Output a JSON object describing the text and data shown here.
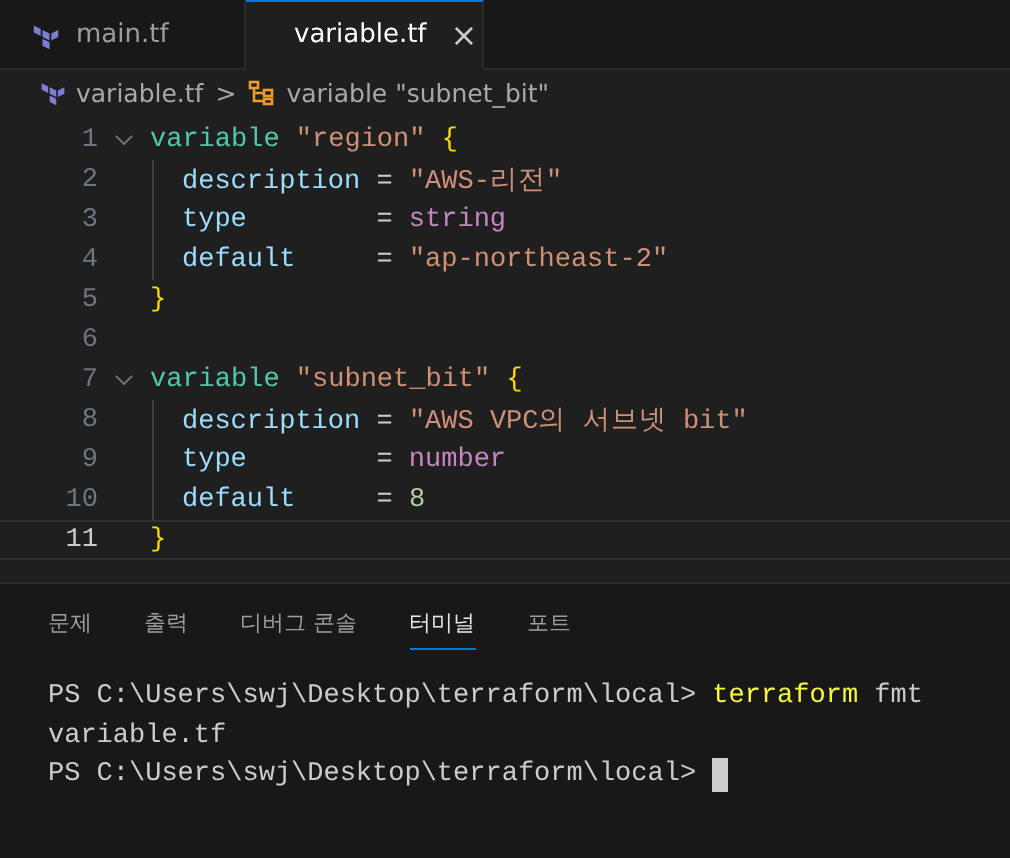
{
  "tabs": [
    {
      "label": "main.tf",
      "selected": false
    },
    {
      "label": "variable.tf",
      "selected": true,
      "close": "×"
    }
  ],
  "breadcrumbs": {
    "file": "variable.tf",
    "separator": ">",
    "symbol": "variable \"subnet_bit\""
  },
  "code": [
    {
      "number": "1",
      "fold": true,
      "indent": false,
      "current": false,
      "tokens": [
        {
          "kind": "keyword",
          "text": "variable"
        },
        {
          "kind": "label",
          "text": " \"region\""
        },
        {
          "kind": "brace",
          "text": " {"
        }
      ]
    },
    {
      "number": "2",
      "fold": false,
      "indent": true,
      "current": false,
      "tokens": [
        {
          "kind": "attr",
          "text": "description"
        },
        {
          "kind": "plain",
          "text": " = "
        },
        {
          "kind": "string",
          "text": "\"AWS-리전\""
        }
      ]
    },
    {
      "number": "3",
      "fold": false,
      "indent": true,
      "current": false,
      "tokens": [
        {
          "kind": "attr",
          "text": "type"
        },
        {
          "kind": "plain",
          "text": "        = "
        },
        {
          "kind": "type",
          "text": "string"
        }
      ]
    },
    {
      "number": "4",
      "fold": false,
      "indent": true,
      "current": false,
      "tokens": [
        {
          "kind": "attr",
          "text": "default"
        },
        {
          "kind": "plain",
          "text": "     = "
        },
        {
          "kind": "string",
          "text": "\"ap-northeast-2\""
        }
      ]
    },
    {
      "number": "5",
      "fold": false,
      "indent": false,
      "current": false,
      "tokens": [
        {
          "kind": "brace",
          "text": "}"
        }
      ]
    },
    {
      "number": "6",
      "fold": false,
      "indent": false,
      "current": false
    },
    {
      "number": "7",
      "fold": true,
      "indent": false,
      "current": false,
      "tokens": [
        {
          "kind": "keyword",
          "text": "variable"
        },
        {
          "kind": "label",
          "text": " \"subnet_bit\""
        },
        {
          "kind": "brace",
          "text": " {"
        }
      ]
    },
    {
      "number": "8",
      "fold": false,
      "indent": true,
      "current": false,
      "tokens": [
        {
          "kind": "attr",
          "text": "description"
        },
        {
          "kind": "plain",
          "text": " = "
        },
        {
          "kind": "string",
          "text": "\"AWS VPC의 서브넷 bit\""
        }
      ]
    },
    {
      "number": "9",
      "fold": false,
      "indent": true,
      "current": false,
      "tokens": [
        {
          "kind": "attr",
          "text": "type"
        },
        {
          "kind": "plain",
          "text": "        = "
        },
        {
          "kind": "type",
          "text": "number"
        }
      ]
    },
    {
      "number": "10",
      "fold": false,
      "indent": true,
      "current": false,
      "tokens": [
        {
          "kind": "attr",
          "text": "default"
        },
        {
          "kind": "plain",
          "text": "     = "
        },
        {
          "kind": "number",
          "text": "8"
        }
      ]
    },
    {
      "number": "11",
      "fold": false,
      "indent": false,
      "current": true,
      "tokens": [
        {
          "kind": "brace",
          "text": "}"
        }
      ]
    }
  ],
  "panel_tabs": [
    {
      "label": "문제",
      "selected": false
    },
    {
      "label": "출력",
      "selected": false
    },
    {
      "label": "디버그 콘솔",
      "selected": false
    },
    {
      "label": "터미널",
      "selected": true
    },
    {
      "label": "포트",
      "selected": false
    }
  ],
  "terminal": [
    {
      "tokens": [
        {
          "kind": "plain",
          "text": "PS C:\\Users\\swj\\Desktop\\terraform\\local> "
        },
        {
          "kind": "command",
          "text": "terraform"
        },
        {
          "kind": "plain",
          "text": " fmt"
        }
      ],
      "cursor": false
    },
    {
      "tokens": [
        {
          "kind": "plain",
          "text": "variable.tf"
        }
      ],
      "cursor": false
    },
    {
      "tokens": [
        {
          "kind": "plain",
          "text": "PS C:\\Users\\swj\\Desktop\\terraform\\local> "
        }
      ],
      "cursor": true
    }
  ]
}
